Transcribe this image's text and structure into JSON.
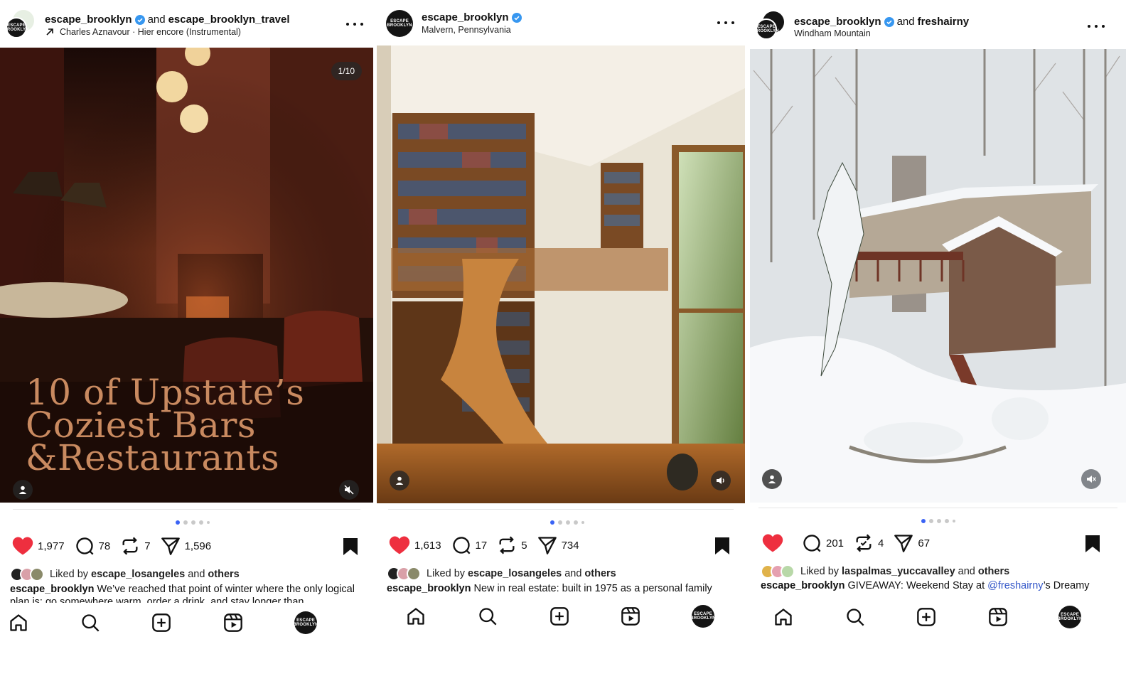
{
  "colors": {
    "like_red": "#ee2f3f",
    "verified_blue": "#3797f0",
    "dot_active": "#3a63f5",
    "overlay_text": "#c98a60",
    "mention": "#3558c9"
  },
  "posts": [
    {
      "account": "escape_brooklyn",
      "joiner": "and",
      "collab": "escape_brooklyn_travel",
      "subline": "Charles Aznavour · Hier encore (Instrumental)",
      "subline_icon": "arrow-up-right-icon",
      "counter": "1/10",
      "overlay_title": [
        "10 of Upstate’s",
        "Coziest Bars",
        "&Restaurants"
      ],
      "audio_icon": "muted-speaker-icon",
      "likes": "1,977",
      "comments": "78",
      "reposts": "7",
      "shares": "1,596",
      "liked_by_prefix": "Liked by",
      "liked_by_user": "escape_losangeles",
      "liked_by_and": "and",
      "liked_by_others": "others",
      "caption_user": "escape_brooklyn",
      "caption_text": "We’ve reached that point of winter where the only logical plan is: go somewhere warm, order a drink, and stay longer than"
    },
    {
      "account": "escape_brooklyn",
      "subline": "Malvern, Pennsylvania",
      "audio_icon": "speaker-icon",
      "likes": "1,613",
      "comments": "17",
      "reposts": "5",
      "shares": "734",
      "liked_by_prefix": "Liked by",
      "liked_by_user": "escape_losangeles",
      "liked_by_and": "and",
      "liked_by_others": "others",
      "caption_user": "escape_brooklyn",
      "caption_text": "New in real estate: built in 1975 as a personal family"
    },
    {
      "account": "escape_brooklyn",
      "joiner": "and",
      "collab": "freshairny",
      "subline": "Windham Mountain",
      "audio_icon": "muted-speaker-icon",
      "likes_hidden": true,
      "comments": "201",
      "reposts": "4",
      "shares": "67",
      "liked_by_prefix": "Liked by",
      "liked_by_user": "laspalmas_yuccavalley",
      "liked_by_and": "and",
      "liked_by_others": "others",
      "caption_user": "escape_brooklyn",
      "caption_text_before": "GIVEAWAY: Weekend Stay at",
      "caption_mention": "@freshairny",
      "caption_text_after": "’s Dreamy"
    }
  ],
  "avatar_logo_text": "ESCAPE BROOKLYN",
  "nav": [
    "home-icon",
    "search-icon",
    "create-icon",
    "reels-icon",
    "profile-avatar"
  ]
}
